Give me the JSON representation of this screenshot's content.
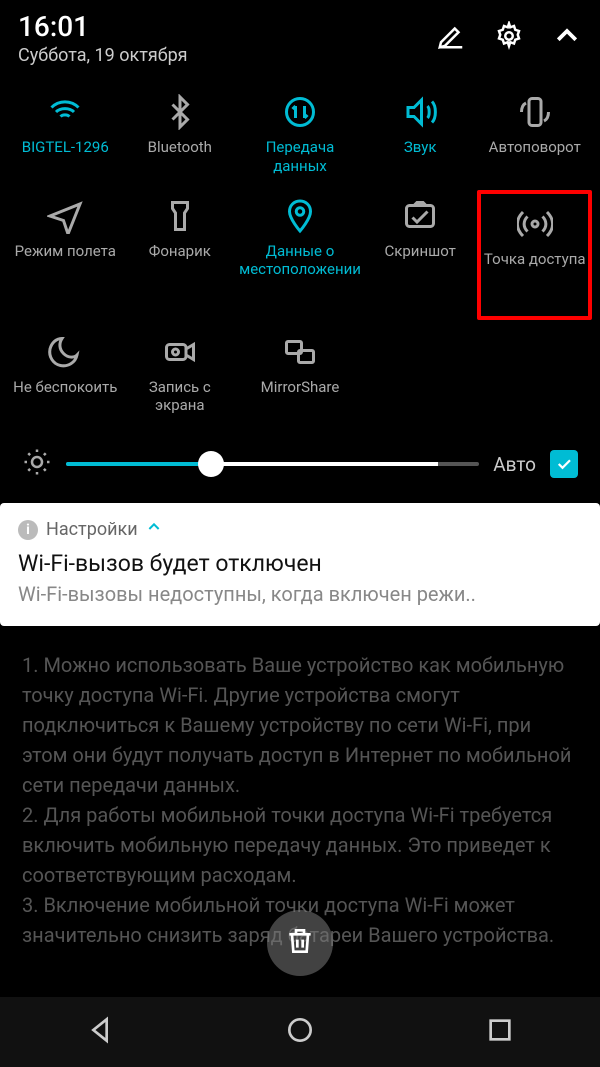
{
  "status": {
    "time": "16:01",
    "date": "Суббота, 19 октября"
  },
  "tiles": [
    {
      "label": "BIGTEL-1296",
      "icon": "wifi",
      "active": true
    },
    {
      "label": "Bluetooth",
      "icon": "bluetooth",
      "active": false
    },
    {
      "label": "Передача данных",
      "icon": "data",
      "active": true
    },
    {
      "label": "Звук",
      "icon": "sound",
      "active": true
    },
    {
      "label": "Автоповорот",
      "icon": "rotate",
      "active": false
    },
    {
      "label": "Режим полета",
      "icon": "airplane",
      "active": false
    },
    {
      "label": "Фонарик",
      "icon": "flashlight",
      "active": false
    },
    {
      "label": "Данные о местоположении",
      "icon": "location",
      "active": true
    },
    {
      "label": "Скриншот",
      "icon": "screenshot",
      "active": false
    },
    {
      "label": "Точка доступа",
      "icon": "hotspot",
      "active": false,
      "highlight": true
    },
    {
      "label": "Не беспокоить",
      "icon": "moon",
      "active": false
    },
    {
      "label": "Запись с экрана",
      "icon": "record",
      "active": false
    },
    {
      "label": "MirrorShare",
      "icon": "mirror",
      "active": false
    }
  ],
  "brightness": {
    "auto_label": "Авто",
    "auto_checked": true
  },
  "notification": {
    "app": "Настройки",
    "title": "Wi-Fi-вызов будет отключен",
    "body": "Wi-Fi-вызовы недоступны, когда включен режи.."
  },
  "background_text": "1. Можно использовать Ваше устройство как мобильную точку доступа Wi-Fi. Другие устройства смогут подключиться к Вашему устройству по сети Wi-Fi, при этом они будут получать доступ в Интернет по мобильной сети передачи данных.\n2. Для работы мобильной точки доступа Wi-Fi требуется включить мобильную передачу данных. Это приведет к соответствующим расходам.\n3. Включение мобильной точки доступа Wi-Fi может значительно снизить заряд батареи Вашего устройства."
}
